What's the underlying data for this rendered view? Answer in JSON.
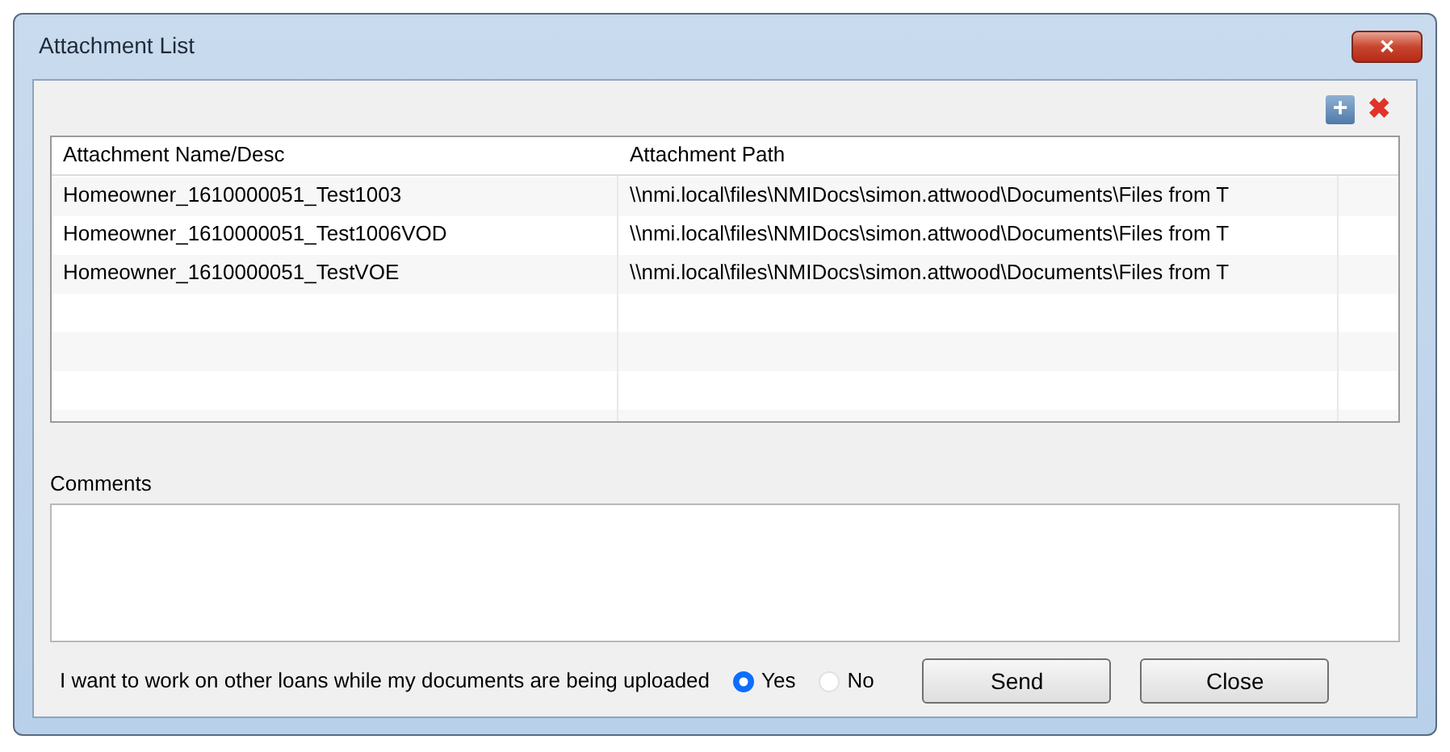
{
  "window": {
    "title": "Attachment List",
    "close_label": "✕"
  },
  "toolbar": {
    "add_label": "+",
    "remove_label": "✖"
  },
  "table": {
    "columns": [
      "Attachment Name/Desc",
      "Attachment Path"
    ],
    "rows": [
      {
        "name": "Homeowner_1610000051_Test1003",
        "path": "\\\\nmi.local\\files\\NMIDocs\\simon.attwood\\Documents\\Files from T"
      },
      {
        "name": "Homeowner_1610000051_Test1006VOD",
        "path": "\\\\nmi.local\\files\\NMIDocs\\simon.attwood\\Documents\\Files from T"
      },
      {
        "name": "Homeowner_1610000051_TestVOE",
        "path": "\\\\nmi.local\\files\\NMIDocs\\simon.attwood\\Documents\\Files from T"
      }
    ]
  },
  "comments": {
    "label": "Comments"
  },
  "footer": {
    "question": "I want to work on other loans while my documents are being uploaded",
    "options": [
      {
        "label": "Yes",
        "selected": true
      },
      {
        "label": "No",
        "selected": false
      }
    ],
    "buttons": [
      "Send",
      "Close"
    ]
  }
}
